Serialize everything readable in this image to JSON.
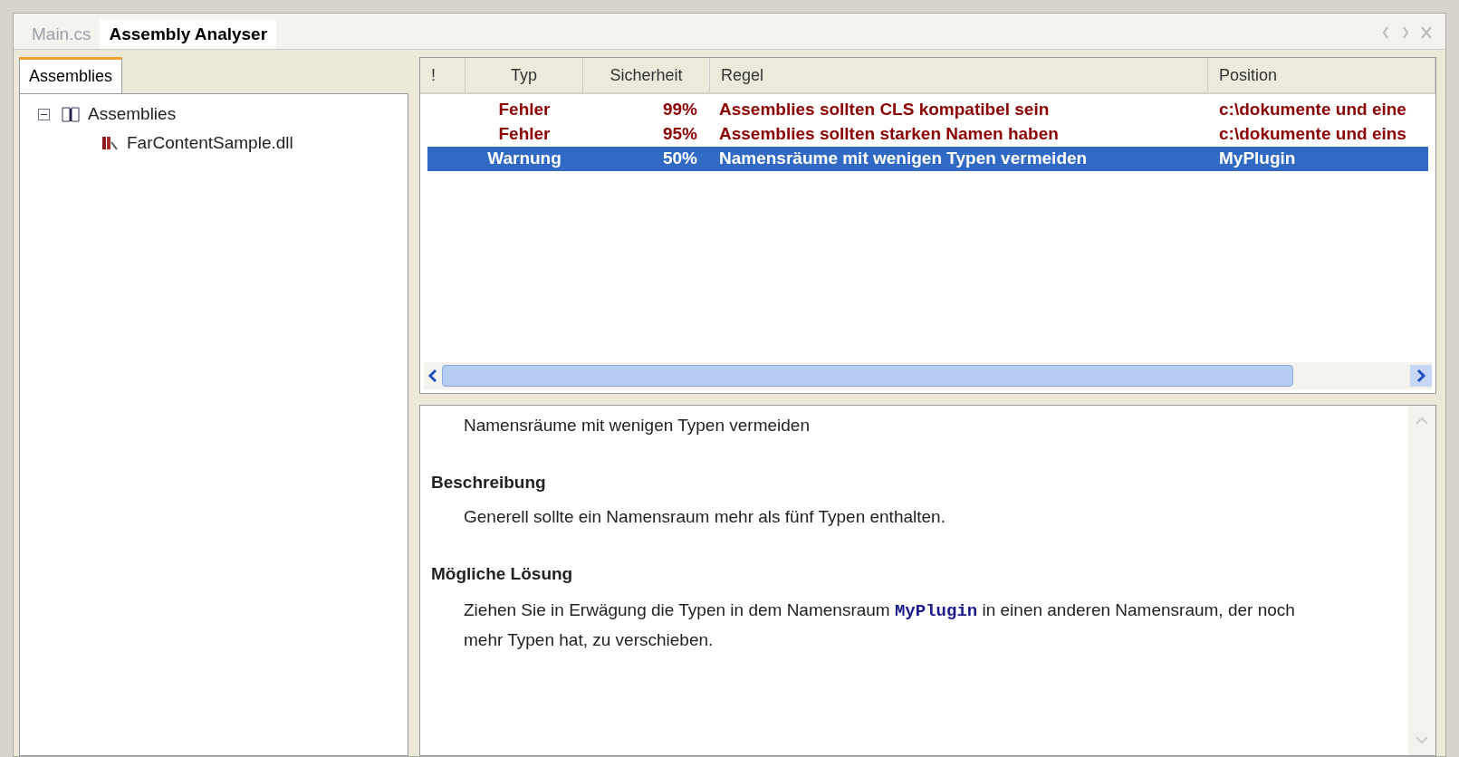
{
  "document_tabs": [
    {
      "label": "Main.cs",
      "selected": false
    },
    {
      "label": "Assembly Analyser",
      "selected": true
    }
  ],
  "left_panel": {
    "tabs": [
      {
        "label": "Assemblies",
        "selected": true
      }
    ],
    "tree": [
      {
        "label": "Assemblies",
        "kind": "folder",
        "expanded": true,
        "children": [
          {
            "label": "FarContentSample.dll",
            "kind": "assembly"
          }
        ]
      }
    ]
  },
  "results_table": {
    "columns": [
      "!",
      "Typ",
      "Sicherheit",
      "Regel",
      "Position"
    ],
    "rows": [
      {
        "type": "Fehler",
        "certainty": "99%",
        "rule": "Assemblies sollten CLS kompatibel sein",
        "position": "c:\\dokumente und eine",
        "selected": false,
        "color": "#8b0000"
      },
      {
        "type": "Fehler",
        "certainty": "95%",
        "rule": "Assemblies sollten starken Namen haben",
        "position": "c:\\dokumente und eins",
        "selected": false,
        "color": "#8b0000"
      },
      {
        "type": "Warnung",
        "certainty": "50%",
        "rule": "Namensräume mit wenigen Typen vermeiden",
        "position": "MyPlugin",
        "selected": true
      }
    ]
  },
  "details": {
    "title": "Namensräume mit wenigen Typen vermeiden",
    "sections": [
      {
        "heading": "Beschreibung",
        "text": "Generell sollte ein Namensraum mehr als fünf Typen enthalten."
      },
      {
        "heading": "Mögliche Lösung",
        "text_before": "Ziehen Sie in Erwägung die Typen in dem Namensraum ",
        "code": "MyPlugin",
        "text_after": " in einen anderen Namensraum, der noch mehr Typen hat, zu verschieben."
      }
    ]
  }
}
